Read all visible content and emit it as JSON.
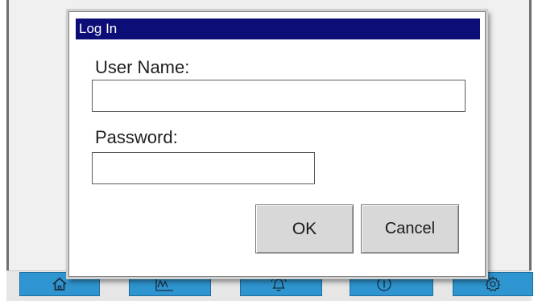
{
  "dialog": {
    "title": "Log In",
    "username_label": "User Name:",
    "username_value": "",
    "password_label": "Password:",
    "password_value": "",
    "ok_label": "OK",
    "cancel_label": "Cancel"
  },
  "nav": {
    "items": [
      {
        "icon": "home-icon"
      },
      {
        "icon": "trend-chart-icon"
      },
      {
        "icon": "alarm-bell-icon"
      },
      {
        "icon": "info-icon"
      },
      {
        "icon": "settings-gear-icon"
      }
    ]
  },
  "colors": {
    "titlebar": "#0d0d78",
    "nav_button": "#2f95d0",
    "dialog_button": "#d8d8d8"
  }
}
